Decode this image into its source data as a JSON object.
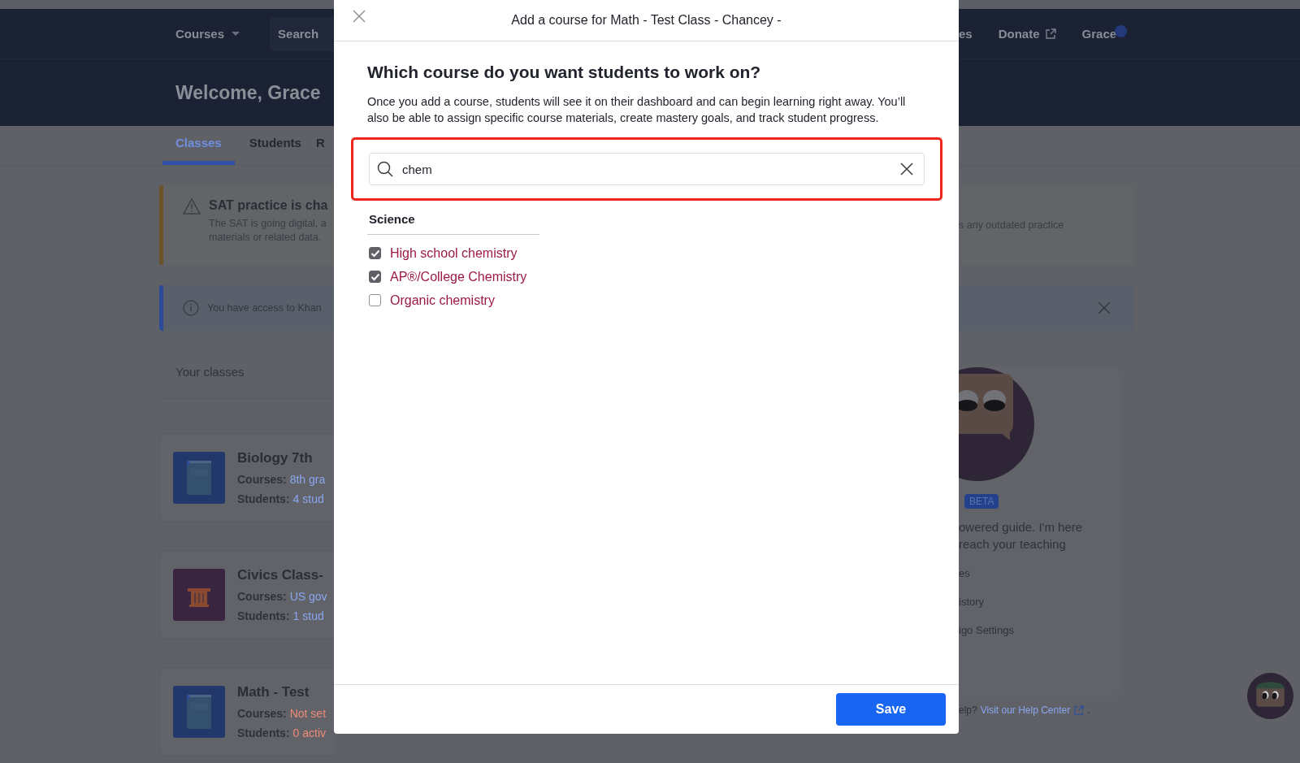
{
  "nav": {
    "courses": "Courses",
    "search": "Search",
    "right_items": [
      {
        "label": "es",
        "external": false,
        "notification": false
      },
      {
        "label": "Donate",
        "external": true,
        "notification": false
      },
      {
        "label": "Grace",
        "external": false,
        "notification": true
      }
    ]
  },
  "hero": {
    "welcome": "Welcome, Grace"
  },
  "tabs": [
    {
      "label": "Classes",
      "selected": true
    },
    {
      "label": "Students",
      "selected": false
    },
    {
      "label": "R",
      "selected": false
    }
  ],
  "alerts": [
    {
      "kind": "warning",
      "title": "SAT practice is cha",
      "lines": [
        "The SAT is going digital, a",
        "materials or related data."
      ],
      "right_text": "s any outdated practice",
      "dismissible": false
    },
    {
      "kind": "info",
      "title": "You have access to Khan",
      "dismissible": true
    }
  ],
  "classes": {
    "heading": "Your classes",
    "items": [
      {
        "name": "Biology 7th",
        "courses_label": "Courses:",
        "courses": "8th gra",
        "courses_missing": false,
        "students_label": "Students:",
        "students": "4 stud",
        "students_missing": false
      },
      {
        "name": "Civics Class-",
        "courses_label": "Courses:",
        "courses": "US gov",
        "courses_missing": false,
        "students_label": "Students:",
        "students": "1 stud",
        "students_missing": false
      },
      {
        "name": "Math - Test",
        "courses_label": "Courses:",
        "courses": "Not set",
        "courses_missing": true,
        "students_label": "Students:",
        "students": "0 activ",
        "students_missing": true
      }
    ]
  },
  "assistant": {
    "badge": "BETA",
    "lines": [
      "owered guide. I'm here",
      "reach your teaching"
    ],
    "links": [
      "es",
      "istory",
      "igo Settings"
    ],
    "help_prefix": "elp?",
    "help_link": "Visit our Help Center",
    "help_suffix": "."
  },
  "modal": {
    "title": "Add a course for Math - Test Class - Chancey -",
    "heading": "Which course do you want students to work on?",
    "description": "Once you add a course, students will see it on their dashboard and can begin learning right away. You’ll also be able to assign specific course materials, create mastery goals, and track student progress.",
    "search": {
      "value": "chem",
      "highlighted": true
    },
    "groups": [
      {
        "name": "Science",
        "courses": [
          {
            "label": "High school chemistry",
            "checked": true
          },
          {
            "label": "AP®/College Chemistry",
            "checked": true
          },
          {
            "label": "Organic chemistry",
            "checked": false
          }
        ]
      }
    ],
    "save": "Save"
  }
}
